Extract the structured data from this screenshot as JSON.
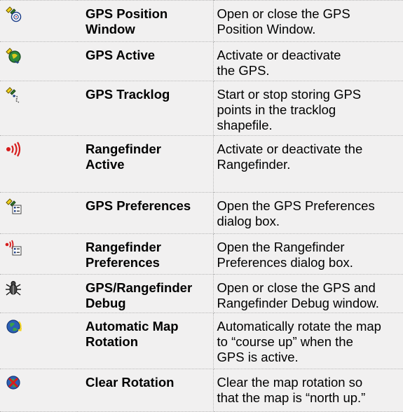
{
  "rows": [
    {
      "icon": "gps-position-window-icon",
      "name": "GPS Position\nWindow",
      "desc": "Open or close the GPS\nPosition Window."
    },
    {
      "icon": "gps-active-icon",
      "name": "GPS Active",
      "desc": "Activate or deactivate\nthe GPS."
    },
    {
      "icon": "gps-tracklog-icon",
      "name": "GPS Tracklog",
      "desc": "Start or stop storing GPS\npoints in the tracklog\nshapefile."
    },
    {
      "icon": "rangefinder-active-icon",
      "name": "Rangefinder\nActive",
      "desc": "Activate or deactivate the\nRangefinder."
    },
    {
      "icon": "gps-preferences-icon",
      "name": "GPS Preferences",
      "desc": "Open the GPS Preferences\ndialog box."
    },
    {
      "icon": "rangefinder-preferences-icon",
      "name": "Rangefinder\nPreferences",
      "desc": "Open the Rangefinder\nPreferences dialog box."
    },
    {
      "icon": "gps-rangefinder-debug-icon",
      "name": "GPS/Rangefinder\nDebug",
      "desc": "Open or close the GPS and\nRangefinder Debug window."
    },
    {
      "icon": "automatic-map-rotation-icon",
      "name": "Automatic Map\nRotation",
      "desc": "Automatically rotate the map\nto “course up” when the\nGPS is active."
    },
    {
      "icon": "clear-rotation-icon",
      "name": "Clear Rotation",
      "desc": "Clear the map rotation so\nthat the map is “north up.”"
    }
  ]
}
